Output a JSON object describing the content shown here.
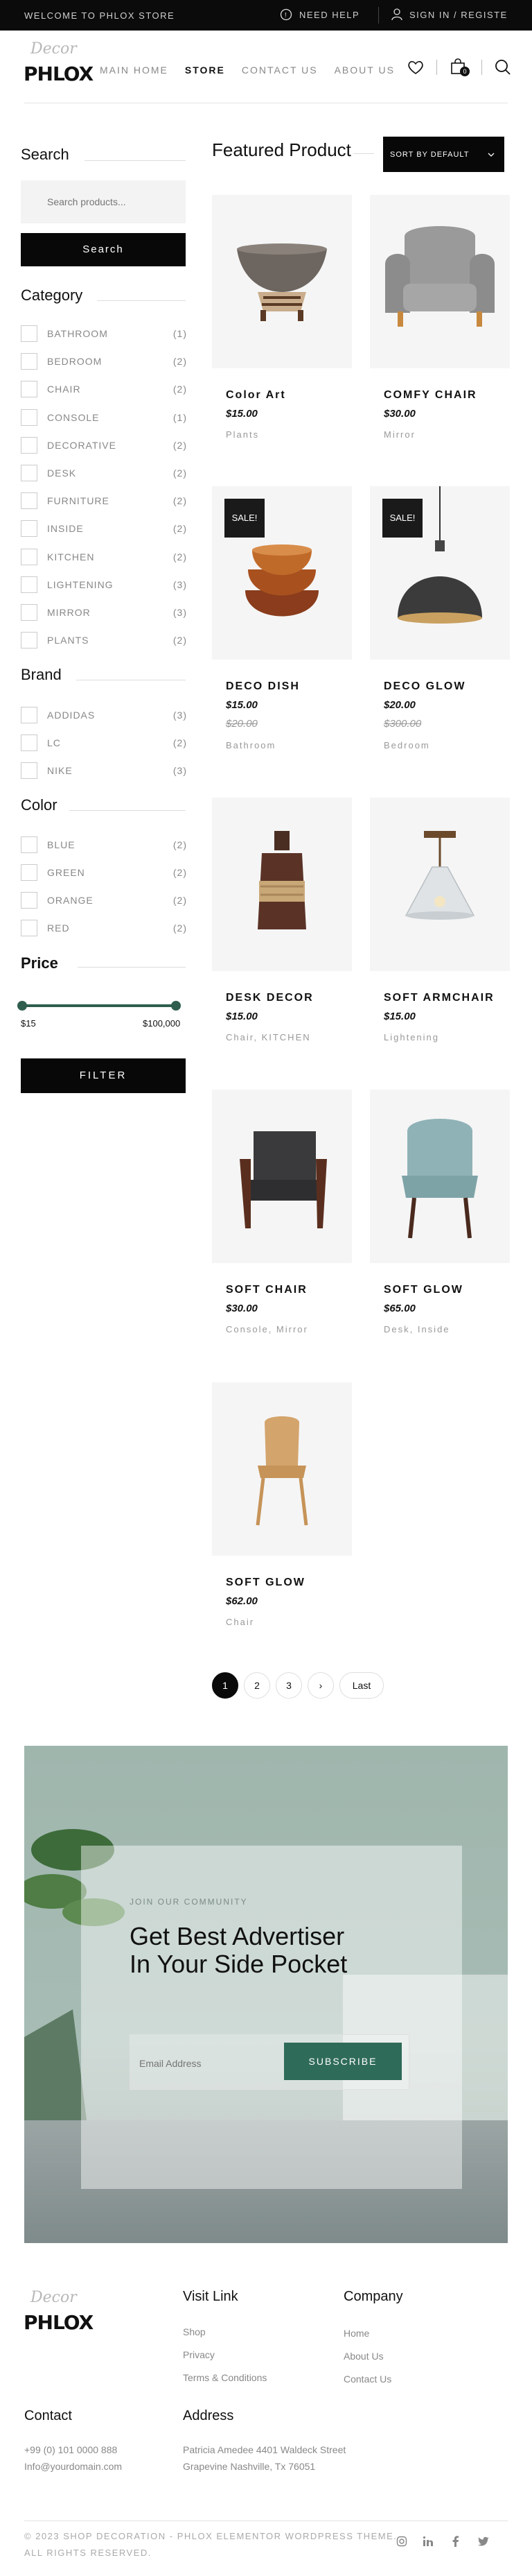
{
  "topbar": {
    "welcome": "WELCOME TO PHLOX STORE",
    "help": "NEED HELP",
    "signin": "SIGN IN / REGISTE"
  },
  "logo": {
    "script": "Decor",
    "word": "PHLOX"
  },
  "nav": {
    "items": [
      {
        "label": "MAIN HOME"
      },
      {
        "label": "STORE"
      },
      {
        "label": "CONTACT US"
      },
      {
        "label": "ABOUT US"
      }
    ]
  },
  "cart": {
    "count": "0"
  },
  "sidebar": {
    "search_title": "Search",
    "search_placeholder": "Search products...",
    "search_button": "Search",
    "category_title": "Category",
    "categories": [
      {
        "label": "BATHROOM",
        "count": "(1)"
      },
      {
        "label": "BEDROOM",
        "count": "(2)"
      },
      {
        "label": "CHAIR",
        "count": "(2)"
      },
      {
        "label": "CONSOLE",
        "count": "(1)"
      },
      {
        "label": "DECORATIVE",
        "count": "(2)"
      },
      {
        "label": "DESK",
        "count": "(2)"
      },
      {
        "label": "FURNITURE",
        "count": "(2)"
      },
      {
        "label": "INSIDE",
        "count": "(2)"
      },
      {
        "label": "KITCHEN",
        "count": "(2)"
      },
      {
        "label": "LIGHTENING",
        "count": "(3)"
      },
      {
        "label": "MIRROR",
        "count": "(3)"
      },
      {
        "label": "PLANTS",
        "count": "(2)"
      }
    ],
    "brand_title": "Brand",
    "brands": [
      {
        "label": "ADDIDAS",
        "count": "(3)"
      },
      {
        "label": "LC",
        "count": "(2)"
      },
      {
        "label": "NIKE",
        "count": "(3)"
      }
    ],
    "color_title": "Color",
    "colors": [
      {
        "label": "BLUE",
        "count": "(2)"
      },
      {
        "label": "GREEN",
        "count": "(2)"
      },
      {
        "label": "ORANGE",
        "count": "(2)"
      },
      {
        "label": "RED",
        "count": "(2)"
      }
    ],
    "price_title": "Price",
    "price_min": "$15",
    "price_max": "$100,000",
    "filter_button": "FILTER"
  },
  "main": {
    "title": "Featured Product",
    "sort_label": "SORT BY DEFAULT",
    "products": [
      {
        "name": "Color Art",
        "price": "$15.00",
        "old_price": "",
        "sale": "",
        "cats": "Plants"
      },
      {
        "name": "COMFY CHAIR",
        "price": "$30.00",
        "old_price": "",
        "sale": "",
        "cats": "Mirror"
      },
      {
        "name": "DECO DISH",
        "price": "$15.00",
        "old_price": "$20.00",
        "sale": "SALE!",
        "cats": "Bathroom"
      },
      {
        "name": "DECO GLOW",
        "price": "$20.00",
        "old_price": "$300.00",
        "sale": "SALE!",
        "cats": "Bedroom"
      },
      {
        "name": "DESK DECOR",
        "price": "$15.00",
        "old_price": "",
        "sale": "",
        "cats": "Chair, KITCHEN"
      },
      {
        "name": "SOFT ARMCHAIR",
        "price": "$15.00",
        "old_price": "",
        "sale": "",
        "cats": "Lightening"
      },
      {
        "name": "SOFT CHAIR",
        "price": "$30.00",
        "old_price": "",
        "sale": "",
        "cats": "Console, Mirror"
      },
      {
        "name": "SOFT GLOW",
        "price": "$65.00",
        "old_price": "",
        "sale": "",
        "cats": "Desk, Inside"
      },
      {
        "name": "SOFT GLOW",
        "price": "$62.00",
        "old_price": "",
        "sale": "",
        "cats": "Chair"
      }
    ],
    "pagination": [
      "1",
      "2",
      "3",
      "›",
      "Last"
    ]
  },
  "newsletter": {
    "kicker": "JOIN OUR COMMUNITY",
    "headline": "Get Best Advertiser In Your Side Pocket",
    "email_placeholder": "Email Address",
    "subscribe": "SUBSCRIBE"
  },
  "footer": {
    "visit_title": "Visit Link",
    "visit_links": [
      "Shop",
      "Privacy",
      "Terms & Conditions"
    ],
    "company_title": "Company",
    "company_links": [
      "Home",
      "About Us",
      "Contact Us"
    ],
    "contact_title": "Contact",
    "phone": "+99 (0) 101 0000 888",
    "email": "Info@yourdomain.com",
    "address_title": "Address",
    "address_line1": "Patricia Amedee 4401 Waldeck Street",
    "address_line2": "Grapevine Nashville, Tx 76051",
    "copyright": "© 2023 SHOP DECORATION - PHLOX ELEMENTOR WORDPRESS THEME. ALL RIGHTS RESERVED."
  }
}
